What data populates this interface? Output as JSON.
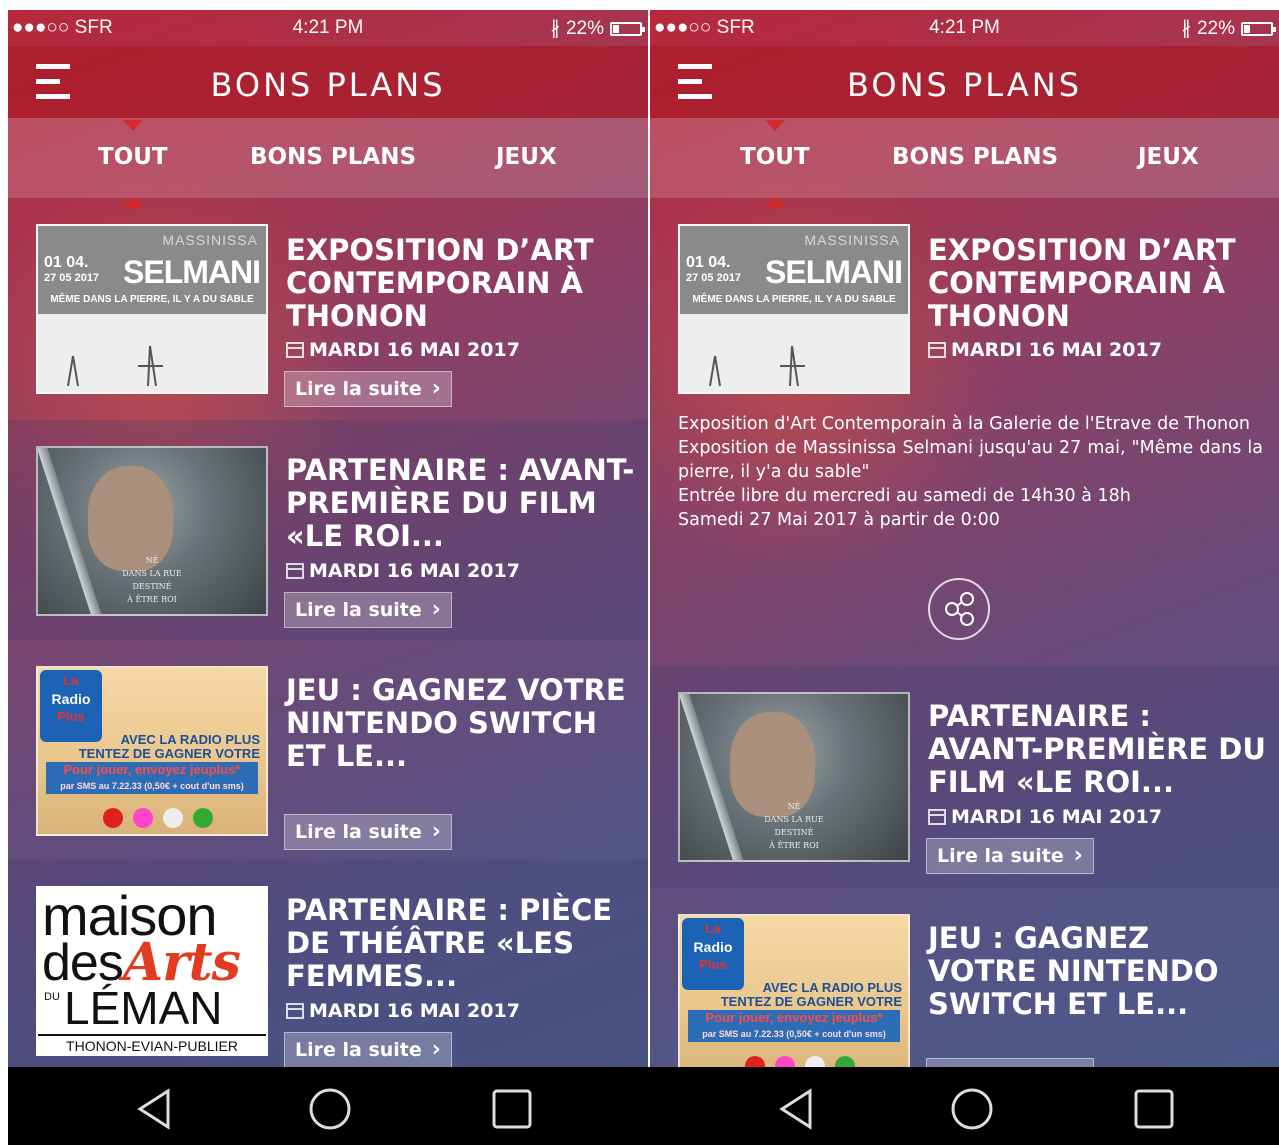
{
  "status": {
    "carrier": "●●●○○ SFR",
    "time": "4:21 PM",
    "battery": "22%",
    "battery_level": 0.22
  },
  "header": {
    "title": "BONS PLANS"
  },
  "tabs": [
    {
      "label": "TOUT",
      "active": true
    },
    {
      "label": "BONS PLANS",
      "active": false
    },
    {
      "label": "JEUX",
      "active": false
    }
  ],
  "articles": [
    {
      "title": "EXPOSITION D’ART CONTEMPORAIN À THONON",
      "date": "MARDI 16 MAI 2017",
      "cta": "Lire la suite",
      "thumb": {
        "name": "MASSINISSA",
        "surname": "SELMANI",
        "date_from": "01 04.",
        "date_to": "27 05 2017",
        "subtitle": "MÊME DANS LA PIERRE, IL Y A DU SABLE"
      }
    },
    {
      "title": "PARTENAIRE : AVANT-PREMIÈRE DU FILM «LE ROI...",
      "date": "MARDI 16 MAI 2017",
      "cta": "Lire la suite",
      "thumb": {
        "l1": "NÉ",
        "l2": "DANS LA RUE",
        "l3": "DESTINÉ",
        "l4": "À ÊTRE ROI"
      }
    },
    {
      "title": "JEU : GAGNEZ VOTRE NINTENDO SWITCH ET LE...",
      "date": "",
      "cta": "Lire la suite",
      "thumb": {
        "logo_top": "La",
        "logo_mid": "Radio",
        "logo_bot": "Plus",
        "line1": "AVEC LA RADIO PLUS",
        "line2": "TENTEZ DE GAGNER VOTRE",
        "box1": "Pour jouer, envoyez jeuplus*",
        "box2": "par SMS au 7.22.33 (0,50€ + cout d'un sms)"
      }
    },
    {
      "title": "PARTENAIRE : PIÈCE DE THÉÂTRE «LES FEMMES...",
      "date": "MARDI 16 MAI 2017",
      "cta": "Lire la suite",
      "thumb": {
        "w1": "maison",
        "w2a": "des",
        "w2b": "Arts",
        "w3": "LÉMAN",
        "du": "DU",
        "w4": "THONON-EVIAN-PUBLIER"
      }
    }
  ],
  "detail": {
    "paragraphs": [
      "Exposition d'Art Contemporain à la Galerie de l'Etrave de Thonon",
      "Exposition de Massinissa Selmani jusqu'au 27 mai, \"Même dans la pierre, il y'a du sable\"",
      "Entrée libre du mercredi au samedi de 14h30 à 18h",
      "Samedi 27 Mai 2017 à partir de 0:00"
    ]
  },
  "colors": {
    "header_red": "#b3202b",
    "tab_indicator": "#d42a2a",
    "gradient_blue": "#4c5a8a"
  }
}
